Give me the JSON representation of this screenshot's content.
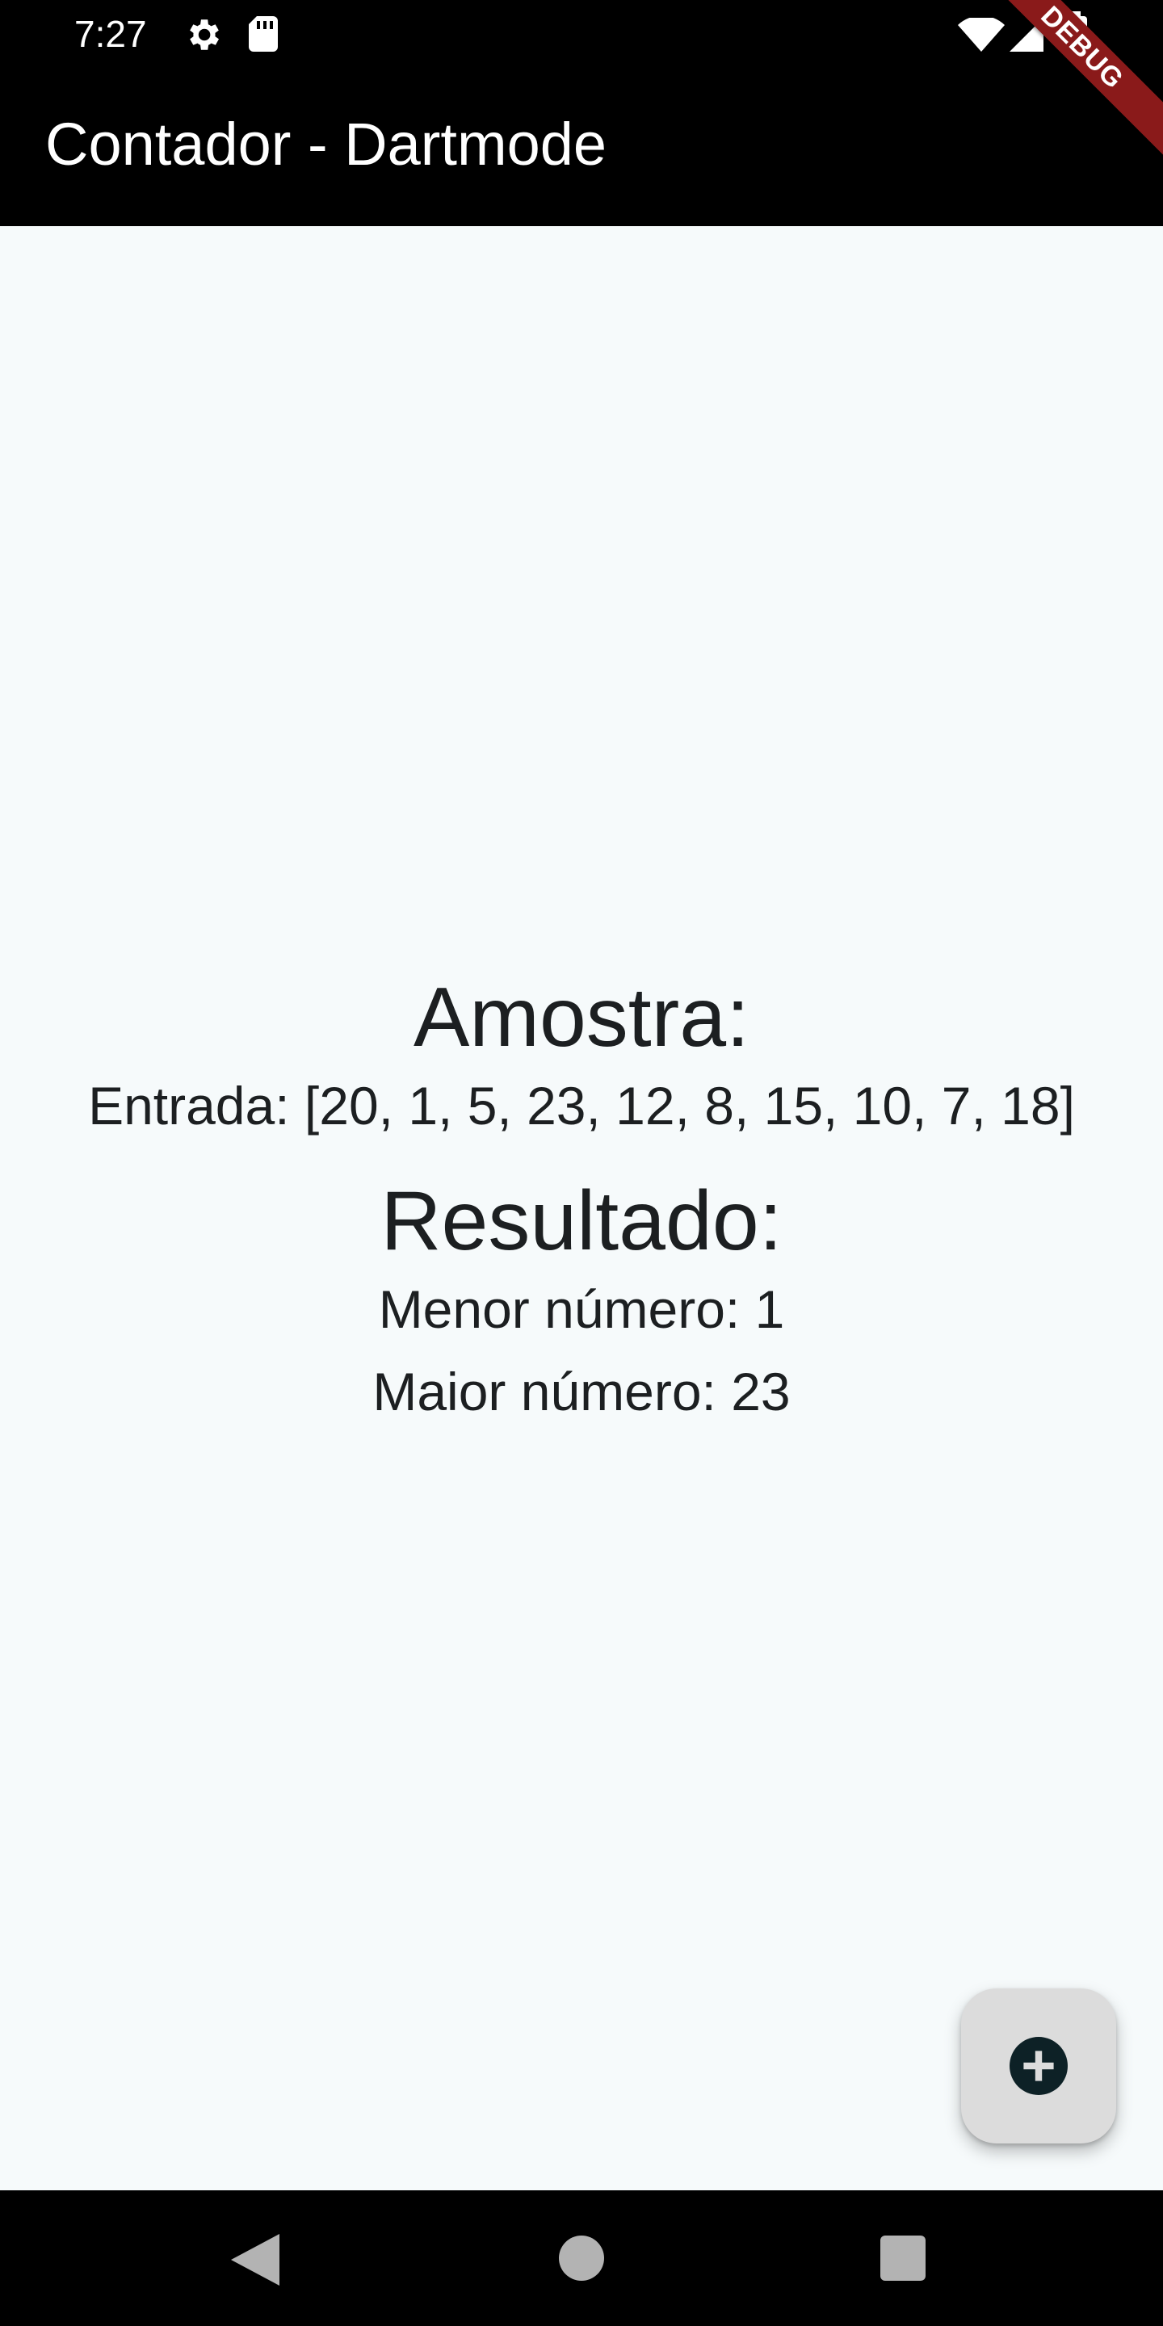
{
  "status_bar": {
    "time": "7:27",
    "icons": [
      "gear-icon",
      "sd-card-icon",
      "wifi-icon",
      "signal-icon",
      "battery-icon"
    ]
  },
  "app_bar": {
    "title": "Contador - Dartmode"
  },
  "debug_banner": {
    "label": "DEBUG",
    "color": "#8a1a1a"
  },
  "main": {
    "sample_heading": "Amostra:",
    "input_text": "Entrada: [20, 1, 5, 23, 12, 8, 15, 10, 7, 18]",
    "result_heading": "Resultado:",
    "min_text": "Menor número: 1",
    "max_text": "Maior número: 23"
  },
  "fab": {
    "icon": "add-circle-icon"
  },
  "nav_bar": {
    "buttons": [
      "back-icon",
      "home-icon",
      "recents-icon"
    ]
  },
  "colors": {
    "app_bar": "#000000",
    "body_background": "#f6fafb",
    "text": "#1c1f21",
    "fab_background": "#dcdcdc",
    "fab_icon": "#0d2126"
  }
}
